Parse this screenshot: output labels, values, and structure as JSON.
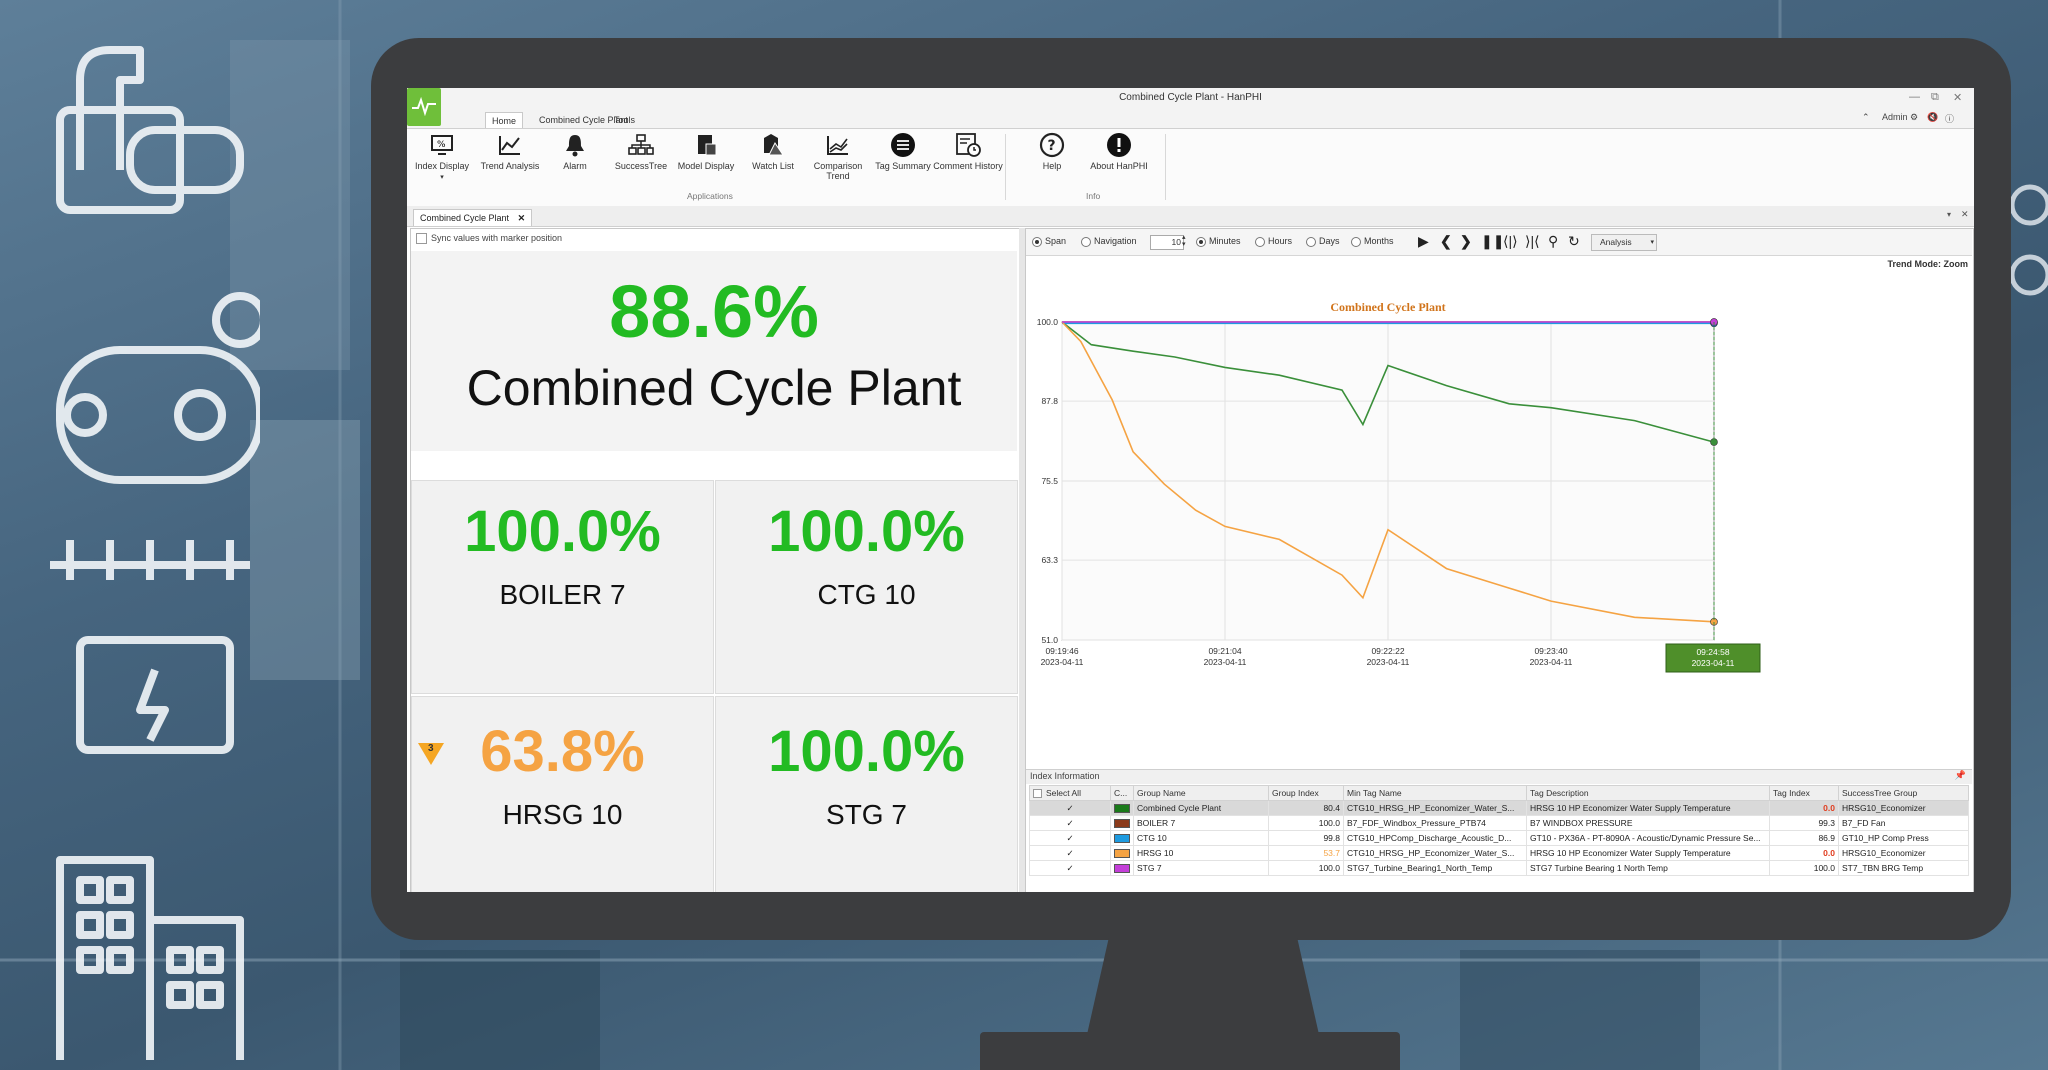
{
  "window": {
    "title": "Combined Cycle Plant - HanPHI",
    "user": "Admin",
    "controls": [
      "minimize-icon",
      "restore-icon",
      "close-icon"
    ]
  },
  "ribbon": {
    "tabs": [
      "Home",
      "Combined Cycle Plant",
      "Tools"
    ],
    "active_tab": "Home",
    "applications": [
      {
        "label": "Index Display",
        "icon": "index-display-icon"
      },
      {
        "label": "Trend Analysis",
        "icon": "trend-analysis-icon"
      },
      {
        "label": "Alarm",
        "icon": "bell-icon"
      },
      {
        "label": "SuccessTree",
        "icon": "success-tree-icon"
      },
      {
        "label": "Model Display",
        "icon": "model-display-icon"
      },
      {
        "label": "Watch List",
        "icon": "watch-list-icon"
      },
      {
        "label": "Comparison Trend",
        "icon": "comparison-trend-icon"
      },
      {
        "label": "Tag Summary",
        "icon": "tag-summary-icon"
      },
      {
        "label": "Comment History",
        "icon": "comment-history-icon"
      }
    ],
    "applications_group": "Applications",
    "info": [
      {
        "label": "Help",
        "icon": "help-icon"
      },
      {
        "label": "About HanPHI",
        "icon": "info-icon"
      }
    ],
    "info_group": "Info"
  },
  "document_tab": "Combined Cycle Plant",
  "index_display": {
    "sync_label": "Sync values with marker position",
    "main": {
      "value": "88.6%",
      "name": "Combined Cycle Plant",
      "color": "#22bb22"
    },
    "tiles": [
      {
        "value": "100.0%",
        "name": "BOILER 7",
        "color": "#22bb22"
      },
      {
        "value": "100.0%",
        "name": "CTG 10",
        "color": "#22bb22"
      },
      {
        "value": "63.8%",
        "name": "HRSG 10",
        "color": "#f5a343",
        "alarm": "3"
      },
      {
        "value": "100.0%",
        "name": "STG 7",
        "color": "#22bb22"
      }
    ]
  },
  "trend_toolbar": {
    "span_label": "Span",
    "navigation_label": "Navigation",
    "span_value": "10",
    "units": [
      "Minutes",
      "Hours",
      "Days",
      "Months"
    ],
    "selected_unit": "Minutes",
    "analysis_label": "Analysis",
    "trend_mode": "Trend Mode: Zoom"
  },
  "chart_data": {
    "type": "line",
    "title": "Combined Cycle Plant",
    "xlabel": "",
    "ylabel": "",
    "ylim": [
      51.0,
      100.0
    ],
    "y_ticks": [
      "100.0",
      "87.8",
      "75.5",
      "63.3",
      "51.0"
    ],
    "x_ticks": [
      {
        "time": "09:19:46",
        "date": "2023-04-11"
      },
      {
        "time": "09:21:04",
        "date": "2023-04-11"
      },
      {
        "time": "09:22:22",
        "date": "2023-04-11"
      },
      {
        "time": "09:23:40",
        "date": "2023-04-11"
      }
    ],
    "marker_label": {
      "time": "09:24:58",
      "date": "2023-04-11"
    },
    "grid": true,
    "series": [
      {
        "name": "Combined Cycle Plant",
        "color": "#3a8f3a",
        "x": [
          "09:19:46",
          "09:20:00",
          "09:20:20",
          "09:20:40",
          "09:21:04",
          "09:21:30",
          "09:22:00",
          "09:22:10",
          "09:22:22",
          "09:22:50",
          "09:23:20",
          "09:23:40",
          "09:24:20",
          "09:24:58"
        ],
        "values": [
          100.0,
          96.5,
          95.5,
          94.6,
          93.0,
          91.8,
          89.5,
          84.2,
          93.3,
          90.2,
          87.4,
          86.8,
          84.8,
          81.5
        ]
      },
      {
        "name": "BOILER 7",
        "color": "#8b3a1a",
        "x": [
          "09:19:46",
          "09:24:58"
        ],
        "values": [
          100.0,
          100.0
        ]
      },
      {
        "name": "CTG 10",
        "color": "#1e9be0",
        "x": [
          "09:19:46",
          "09:24:58"
        ],
        "values": [
          99.8,
          99.8
        ]
      },
      {
        "name": "HRSG 10",
        "color": "#f5a343",
        "x": [
          "09:19:46",
          "09:19:55",
          "09:20:10",
          "09:20:20",
          "09:20:35",
          "09:20:50",
          "09:21:04",
          "09:21:30",
          "09:22:00",
          "09:22:10",
          "09:22:22",
          "09:22:50",
          "09:23:20",
          "09:23:40",
          "09:24:20",
          "09:24:58"
        ],
        "values": [
          100.0,
          97.0,
          88.0,
          80.0,
          75.0,
          71.0,
          68.5,
          66.5,
          61.0,
          57.5,
          68.0,
          62.0,
          59.0,
          57.0,
          54.5,
          53.8
        ]
      },
      {
        "name": "STG 7",
        "color": "#c43fd8",
        "x": [
          "09:19:46",
          "09:24:58"
        ],
        "values": [
          100.0,
          100.0
        ]
      }
    ]
  },
  "index_information": {
    "title": "Index Information",
    "columns": [
      "Select All",
      "C...",
      "Group Name",
      "Group Index",
      "Min Tag Name",
      "Tag Description",
      "Tag Index",
      "SuccessTree Group"
    ],
    "rows": [
      {
        "checked": true,
        "color": "#1a7a1a",
        "group": "Combined Cycle Plant",
        "group_index": "80.4",
        "min_tag": "CTG10_HRSG_HP_Economizer_Water_S...",
        "desc": "HRSG 10 HP Economizer Water Supply Temperature",
        "tag_index": "0.0",
        "tag_index_color": "#e03c1e",
        "st_group": "HRSG10_Economizer",
        "selected": true
      },
      {
        "checked": true,
        "color": "#8b3a1a",
        "group": "BOILER 7",
        "group_index": "100.0",
        "min_tag": "B7_FDF_Windbox_Pressure_PTB74",
        "desc": "B7 WINDBOX PRESSURE",
        "tag_index": "99.3",
        "tag_index_color": "#222222",
        "st_group": "B7_FD Fan"
      },
      {
        "checked": true,
        "color": "#1e9be0",
        "group": "CTG 10",
        "group_index": "99.8",
        "min_tag": "CTG10_HPComp_Discharge_Acoustic_D...",
        "desc": "GT10 - PX36A - PT-8090A - Acoustic/Dynamic Pressure Se...",
        "tag_index": "86.9",
        "tag_index_color": "#222222",
        "st_group": "GT10_HP Comp Press"
      },
      {
        "checked": true,
        "color": "#f5a343",
        "group": "HRSG 10",
        "group_index": "53.7",
        "group_index_color": "#f5a343",
        "min_tag": "CTG10_HRSG_HP_Economizer_Water_S...",
        "desc": "HRSG 10 HP Economizer Water Supply Temperature",
        "tag_index": "0.0",
        "tag_index_color": "#e03c1e",
        "st_group": "HRSG10_Economizer"
      },
      {
        "checked": true,
        "color": "#c43fd8",
        "group": "STG 7",
        "group_index": "100.0",
        "min_tag": "STG7_Turbine_Bearing1_North_Temp",
        "desc": "STG7 Turbine Bearing 1 North Temp",
        "tag_index": "100.0",
        "tag_index_color": "#222222",
        "st_group": "ST7_TBN BRG Temp"
      }
    ]
  }
}
